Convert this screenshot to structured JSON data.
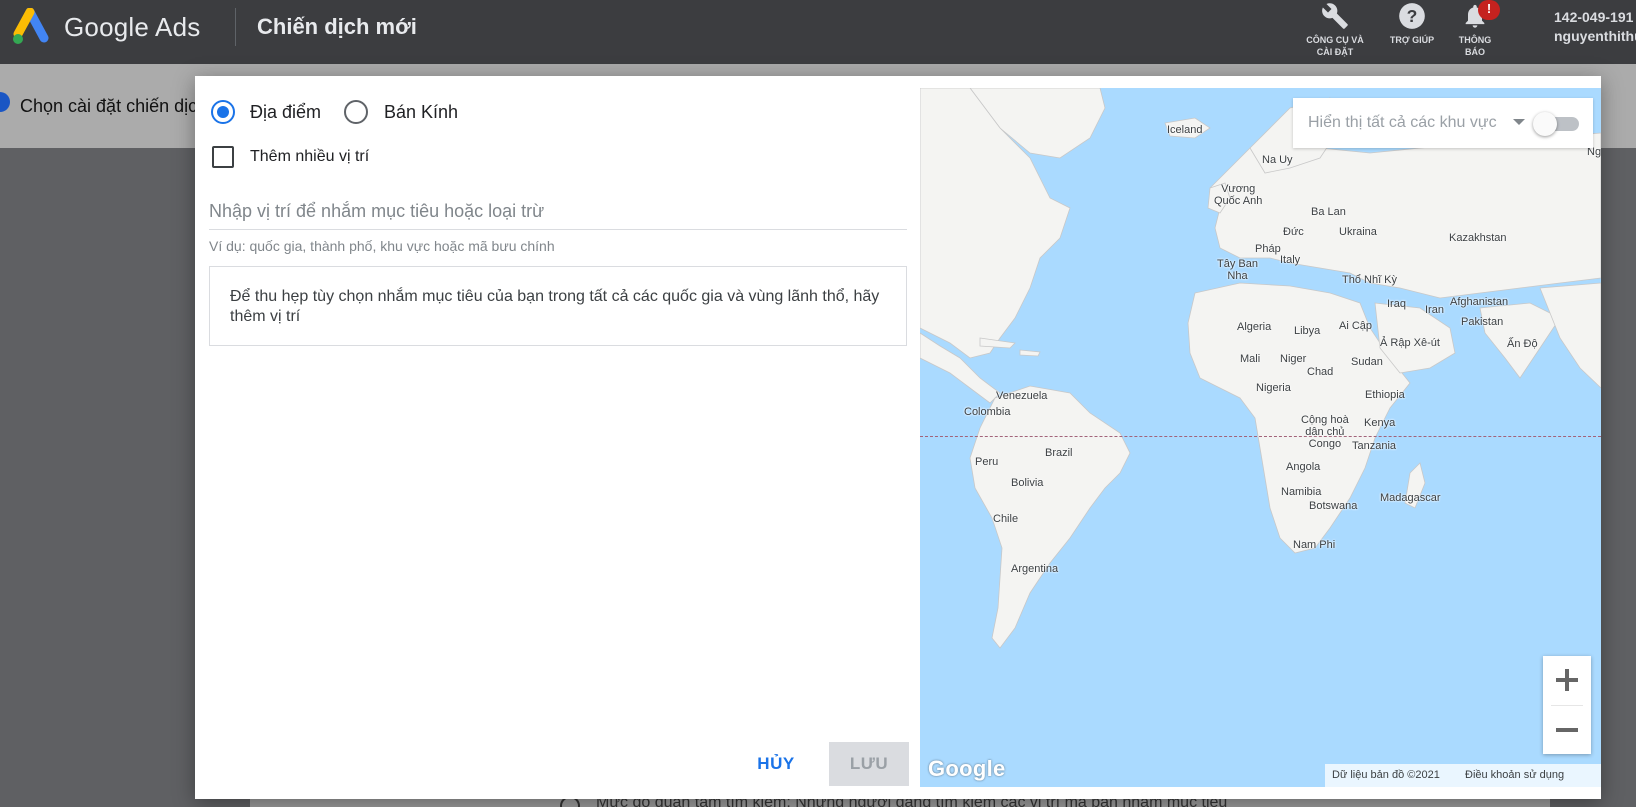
{
  "header": {
    "brand": "Google Ads",
    "page_title": "Chiến dịch mới",
    "tools_label_1": "CÔNG CỤ VÀ",
    "tools_label_2": "CÀI ĐẶT",
    "help_label": "TRỢ GIÚP",
    "notif_label_1": "THÔNG",
    "notif_label_2": "BÁO",
    "notif_badge": "!",
    "account_id": "142-049-191",
    "account_name": "nguyenthithu"
  },
  "background": {
    "step_label": "Chọn cài đặt chiến dịch",
    "bottom_text": "Mức độ quan tâm tìm kiếm: Những người đang tìm kiếm các vị trí mà bạn nhắm mục tiêu"
  },
  "dialog": {
    "radio_location": "Địa điểm",
    "radio_radius": "Bán Kính",
    "checkbox_multi": "Thêm nhiều vị trí",
    "input_placeholder": "Nhập vị trí để nhắm mục tiêu hoặc loại trừ",
    "input_hint": "Ví dụ: quốc gia, thành phố, khu vực hoặc mã bưu chính",
    "info_text": "Để thu hẹp tùy chọn nhắm mục tiêu của bạn trong tất cả các quốc gia và vùng lãnh thổ, hãy thêm vị trí",
    "cancel_label": "HỦY",
    "save_label": "LƯU"
  },
  "map": {
    "filter_label": "Hiển thị tất cả các khu vực",
    "google_logo": "Google",
    "data_credit": "Dữ liệu bản đồ ©2021",
    "terms": "Điều khoản sử dụng",
    "labels": {
      "iceland": "Iceland",
      "norway": "Na Uy",
      "uk_1": "Vương",
      "uk_2": "Quốc Anh",
      "poland": "Ba Lan",
      "germany": "Đức",
      "ukraine": "Ukraina",
      "kazakhstan": "Kazakhstan",
      "france": "Pháp",
      "spain_1": "Tây Ban",
      "spain_2": "Nha",
      "italy": "Italy",
      "turkey": "Thổ Nhĩ Kỳ",
      "iraq": "Iraq",
      "iran": "Iran",
      "afghanistan": "Afghanistan",
      "pakistan": "Pakistan",
      "algeria": "Algeria",
      "libya": "Libya",
      "egypt": "Ai Cập",
      "saudi": "Ả Rập Xê-út",
      "india": "Ấn Độ",
      "mali": "Mali",
      "niger": "Niger",
      "sudan": "Sudan",
      "chad": "Chad",
      "nigeria": "Nigeria",
      "ethiopia": "Ethiopia",
      "venezuela": "Venezuela",
      "colombia": "Colombia",
      "drc_1": "Cộng hoà",
      "drc_2": "dân chủ",
      "drc_3": "Congo",
      "kenya": "Kenya",
      "tanzania": "Tanzania",
      "brazil": "Brazil",
      "peru": "Peru",
      "angola": "Angola",
      "bolivia": "Bolivia",
      "namibia": "Namibia",
      "botswana": "Botswana",
      "madagascar": "Madagascar",
      "chile": "Chile",
      "south_africa": "Nam Phi",
      "argentina": "Argentina",
      "nga": "Nga"
    }
  },
  "colors": {
    "accent": "#1a73e8",
    "topbar": "#3c3d40",
    "ocean": "#aadaff",
    "land": "#f4f4f2"
  }
}
